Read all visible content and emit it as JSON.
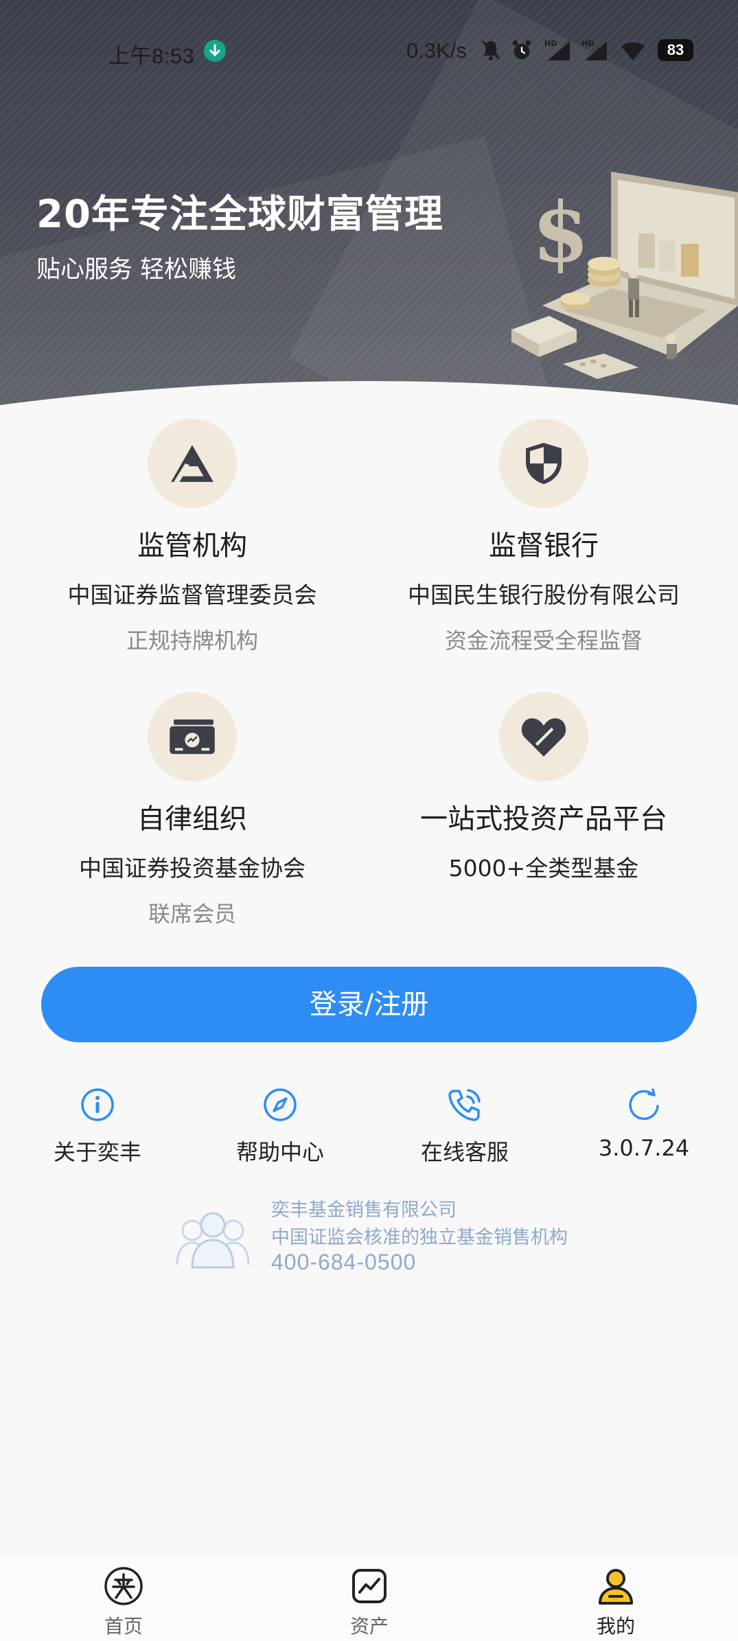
{
  "status_bar": {
    "time": "上午8:53",
    "net_speed": "0.3K/s",
    "battery": "83"
  },
  "hero": {
    "title": "20年专注全球财富管理",
    "subtitle": "贴心服务 轻松赚钱"
  },
  "features": [
    {
      "icon": "triangle-logo-icon",
      "title": "监管机构",
      "subtitle": "中国证券监督管理委员会",
      "note": "正规持牌机构"
    },
    {
      "icon": "shield-icon",
      "title": "监督银行",
      "subtitle": "中国民生银行股份有限公司",
      "note": "资金流程受全程监督"
    },
    {
      "icon": "card-chart-icon",
      "title": "自律组织",
      "subtitle": "中国证券投资基金协会",
      "note": "联席会员"
    },
    {
      "icon": "heart-icon",
      "title": "一站式投资产品平台",
      "subtitle": "5000+全类型基金",
      "note": ""
    }
  ],
  "login": {
    "label": "登录/注册"
  },
  "quick_links": [
    {
      "icon": "info-icon",
      "label": "关于奕丰"
    },
    {
      "icon": "compass-icon",
      "label": "帮助中心"
    },
    {
      "icon": "phone-icon",
      "label": "在线客服"
    },
    {
      "icon": "refresh-icon",
      "label": "3.0.7.24"
    }
  ],
  "company": {
    "name": "奕丰基金销售有限公司",
    "description": "中国证监会核准的独立基金销售机构",
    "phone": "400-684-0500"
  },
  "tabbar": [
    {
      "icon": "home-logo-icon",
      "label": "首页",
      "active": false
    },
    {
      "icon": "assets-chart-icon",
      "label": "资产",
      "active": false
    },
    {
      "icon": "profile-icon",
      "label": "我的",
      "active": true
    }
  ],
  "colors": {
    "primary": "#2e8cf5",
    "hero_bg": "#454853",
    "icon_circle": "#f0e9dc",
    "icon_dark": "#3c3f47",
    "muted": "#8a8a8e",
    "company_text": "#8fa9cb",
    "profile_accent": "#f6c22a"
  }
}
